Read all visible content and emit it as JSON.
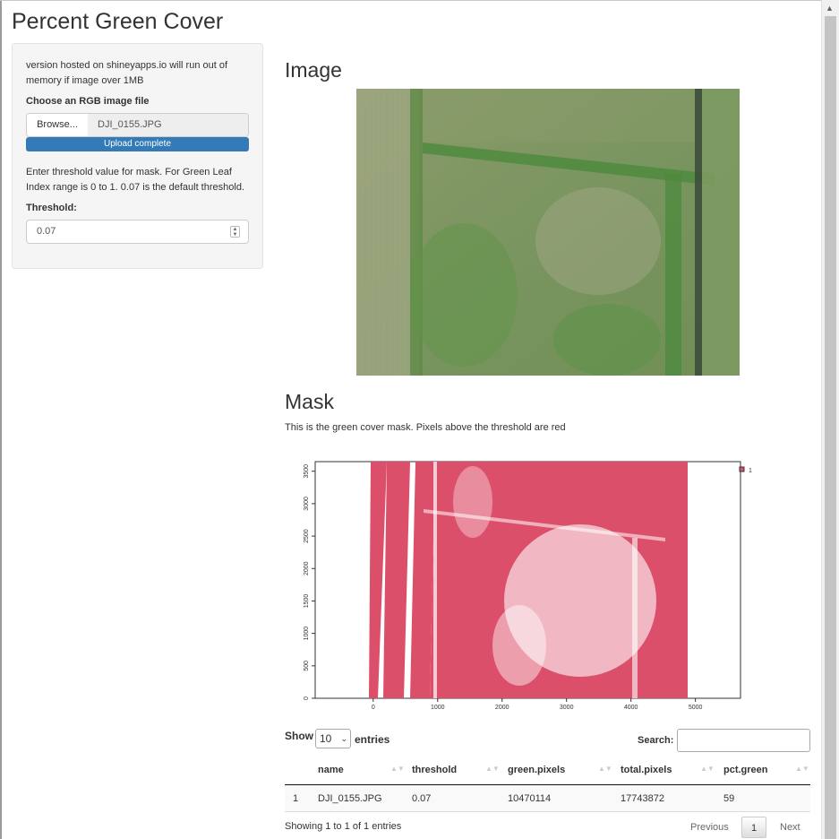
{
  "app": {
    "title": "Percent Green Cover"
  },
  "sidebar": {
    "note": "version hosted on shineyapps.io will run out of memory if image over 1MB",
    "file_label": "Choose an RGB image file",
    "browse_label": "Browse...",
    "file_name": "DJI_0155.JPG",
    "upload_status": "Upload complete",
    "threshold_note": "Enter threshold value for mask. For Green Leaf Index range is 0 to 1. 0.07 is the default threshold.",
    "threshold_label": "Threshold:",
    "threshold_value": "0.07"
  },
  "main": {
    "image_heading": "Image",
    "mask_heading": "Mask",
    "mask_description": "This is the green cover mask. Pixels above the threshold are red"
  },
  "chart_data": {
    "type": "heatmap",
    "x_ticks": [
      "0",
      "1000",
      "2000",
      "3000",
      "4000",
      "5000"
    ],
    "y_ticks": [
      "0",
      "500",
      "1000",
      "1500",
      "2000",
      "2500",
      "3000",
      "3500"
    ],
    "xlim": [
      -900,
      5700
    ],
    "ylim": [
      0,
      3648
    ],
    "legend": [
      "1"
    ],
    "legend_position": "top-right",
    "mask_color": "#dc4f6a"
  },
  "table": {
    "show_label": "Show",
    "page_length": "10",
    "entries_label": "entries",
    "search_label": "Search:",
    "columns": [
      "name",
      "threshold",
      "green.pixels",
      "total.pixels",
      "pct.green"
    ],
    "rows": [
      {
        "index": "1",
        "name": "DJI_0155.JPG",
        "threshold": "0.07",
        "green_pixels": "10470114",
        "total_pixels": "17743872",
        "pct_green": "59"
      }
    ],
    "info": "Showing 1 to 1 of 1 entries",
    "previous": "Previous",
    "current_page": "1",
    "next": "Next"
  }
}
